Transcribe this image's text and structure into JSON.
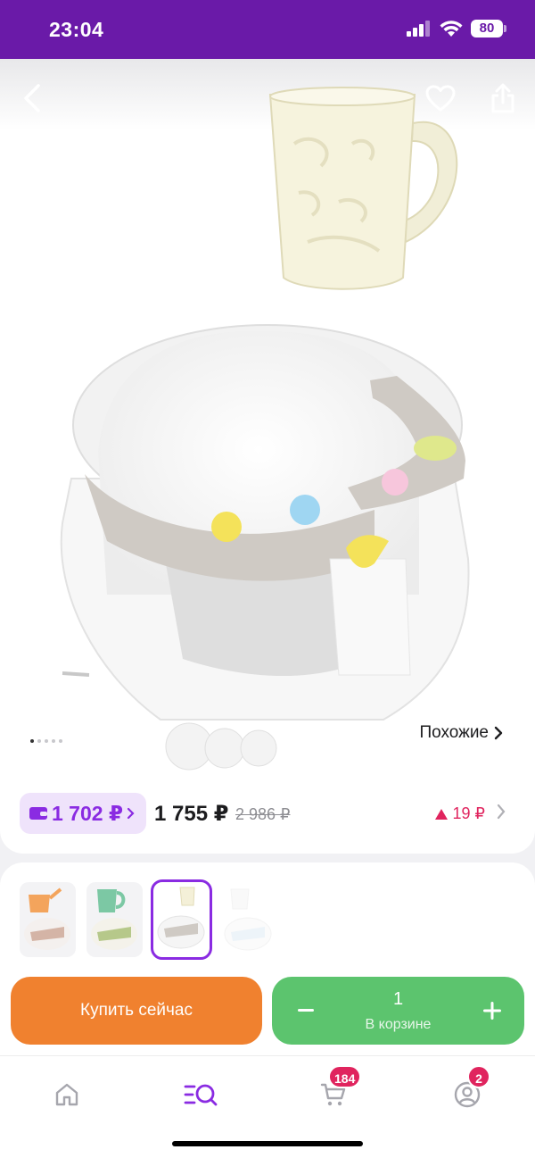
{
  "status_bar": {
    "time": "23:04",
    "battery": "80"
  },
  "product": {
    "image_count": 5,
    "active_image_index": 0,
    "similar_label": "Похожие"
  },
  "price": {
    "wallet_price": "1 702 ₽",
    "current_price": "1 755 ₽",
    "old_price": "2 986 ₽",
    "price_change": "19 ₽",
    "price_change_color": "#e0245e",
    "wallet_color": "#8a2be2"
  },
  "variants": {
    "selected_index": 2,
    "items": [
      {
        "name": "orange-ladle-variant"
      },
      {
        "name": "green-cup-variant"
      },
      {
        "name": "cream-cup-variant"
      },
      {
        "name": "white-cup-variant"
      }
    ]
  },
  "actions": {
    "buy_now_label": "Купить сейчас",
    "cart_quantity": "1",
    "in_cart_label": "В корзине",
    "buy_color": "#f0812f",
    "cart_color": "#5cc46e"
  },
  "tab_bar": {
    "cart_badge": "184",
    "profile_badge": "2",
    "active_tab": "catalog",
    "accent": "#8a2be2"
  }
}
